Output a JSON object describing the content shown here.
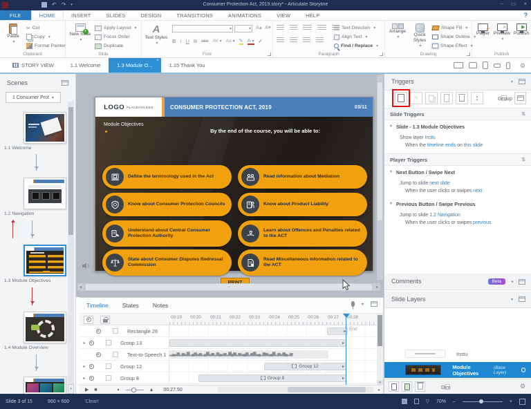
{
  "titlebar": {
    "title": "Consumer Protection Act, 2019.story* - Articulate Storyline"
  },
  "ribbon_tabs": {
    "items": [
      "FILE",
      "HOME",
      "INSERT",
      "SLIDES",
      "DESIGN",
      "TRANSITIONS",
      "ANIMATIONS",
      "VIEW",
      "HELP"
    ],
    "help_mark": "?"
  },
  "ribbon": {
    "clipboard": {
      "paste": "Paste",
      "cut": "Cut",
      "copy": "Copy",
      "format_painter": "Format Painter",
      "group_label": "Clipboard"
    },
    "slide_group": {
      "new_slide": "New Slide",
      "apply_layout": "Apply Layout",
      "focus_order": "Focus Order",
      "duplicate": "Duplicate",
      "group_label": "Slide"
    },
    "font": {
      "text_styles": "Text Styles",
      "bold": "B",
      "italic": "I",
      "underline": "U",
      "strike": "S",
      "abc": "abc",
      "spacing": "AV",
      "aa": "Aa",
      "color_a": "A",
      "grow": "A",
      "shrink": "A",
      "group_label": "Font"
    },
    "paragraph": {
      "text_direction": "Text Direction",
      "align_text": "Align Text",
      "find_replace": "Find / Replace",
      "group_label": "Paragraph"
    },
    "drawing": {
      "arrange": "Arrange",
      "quick_styles": "Quick Styles",
      "shape_fill": "Shape Fill",
      "shape_outline": "Shape Outline",
      "shape_effect": "Shape Effect",
      "group_label": "Drawing"
    },
    "publish": {
      "player": "Player",
      "preview": "Preview",
      "publish": "Publish",
      "group_label": "Publish"
    }
  },
  "tabbar": {
    "story_view": "STORY VIEW",
    "tab_welcome": "1.1 Welcome",
    "tab_module": "1.3 Module O...",
    "tab_thankyou": "1.15 Thank You"
  },
  "scenes": {
    "title": "Scenes",
    "dropdown": "1 Consumer Prot",
    "items": [
      {
        "label": "1.1 Welcome"
      },
      {
        "label": "1.2 Navigation"
      },
      {
        "label": "1.3 Module Objectives"
      },
      {
        "label": "1.4 Module Overview"
      }
    ]
  },
  "slide": {
    "logo": "LOGO",
    "logo_sub": "PLACEHOLDER",
    "title": "CONSUMER PROTECTION ACT, 2019",
    "page": "03/11",
    "heading": "Module Objectives",
    "intro": "By the end of the course, you will be able to:",
    "buttons": [
      {
        "label": "Define the terminology used in the Act"
      },
      {
        "label": "Read information about Mediation"
      },
      {
        "label": "Know about Consumer Protection Councils"
      },
      {
        "label": "Know about Product Liability"
      },
      {
        "label": "Understand about Central Consumer Protection Authority"
      },
      {
        "label": "Learn about Offences and Penalties related to the ACT"
      },
      {
        "label": "State about Consumer Disputes Redressal Commission"
      },
      {
        "label": "Read Miscellaneous information related to the ACT"
      }
    ],
    "print_label": "PRINT"
  },
  "triggers": {
    "title": "Triggers",
    "group_label": "Group",
    "slide_triggers_title": "Slide Triggers",
    "slide_trigger_heading": "Slide - 1.3 Module Objectives",
    "show_layer_pre": "Show layer ",
    "show_layer_link": "Instu",
    "when1_pre": "When the ",
    "when1_link1": "timeline ends",
    "when1_mid": " on ",
    "when1_link2": "this slide",
    "player_triggers_title": "Player Triggers",
    "next_heading": "Next Button / Swipe Next",
    "next_action_pre": "Jump to slide ",
    "next_action_link": "next slide",
    "next_when_pre": "When the user clicks or swipes ",
    "next_when_link": "next",
    "prev_heading": "Previous Button / Swipe Previous",
    "prev_action_pre": "Jump to slide ",
    "prev_action_link": "1.2 Navigation",
    "prev_when_pre": "When the user clicks or swipes ",
    "prev_when_link": "previous"
  },
  "comments": {
    "title": "Comments",
    "badge": "Beta"
  },
  "slide_layers": {
    "title": "Slide Layers",
    "layer1": "Instu",
    "layer2": "Module Objectives",
    "layer2_note": "(Base Layer)",
    "dim_label": "Dim"
  },
  "timeline": {
    "tab_timeline": "Timeline",
    "tab_states": "States",
    "tab_notes": "Notes",
    "ruler": [
      "00:19",
      "00:20",
      "00:21",
      "00:22",
      "00:23",
      "00:24",
      "00:25",
      "00:26",
      "00:27",
      "00:28"
    ],
    "tracks": [
      {
        "name": "Rectangle 26"
      },
      {
        "name": "Group 13"
      },
      {
        "name": "Text-to-Speech 1"
      },
      {
        "name": "Group 12",
        "bar_label": "Group 12"
      },
      {
        "name": "Group 8",
        "bar_label": "Group 8"
      }
    ],
    "end_label": "End",
    "time": "00:27.50"
  },
  "statusbar": {
    "slide_info": "Slide 3 of 15",
    "dimensions": "960 × 600",
    "theme": "'Clean'",
    "zoom": "70%"
  },
  "colors": {
    "accent_blue": "#2b7bc0",
    "selection_blue": "#1e88d2",
    "brand_orange": "#f0a10d",
    "titlebar_navy": "#1f2d52",
    "annotation_red": "#dd1111",
    "slide_header_blue": "#4a7fba"
  }
}
